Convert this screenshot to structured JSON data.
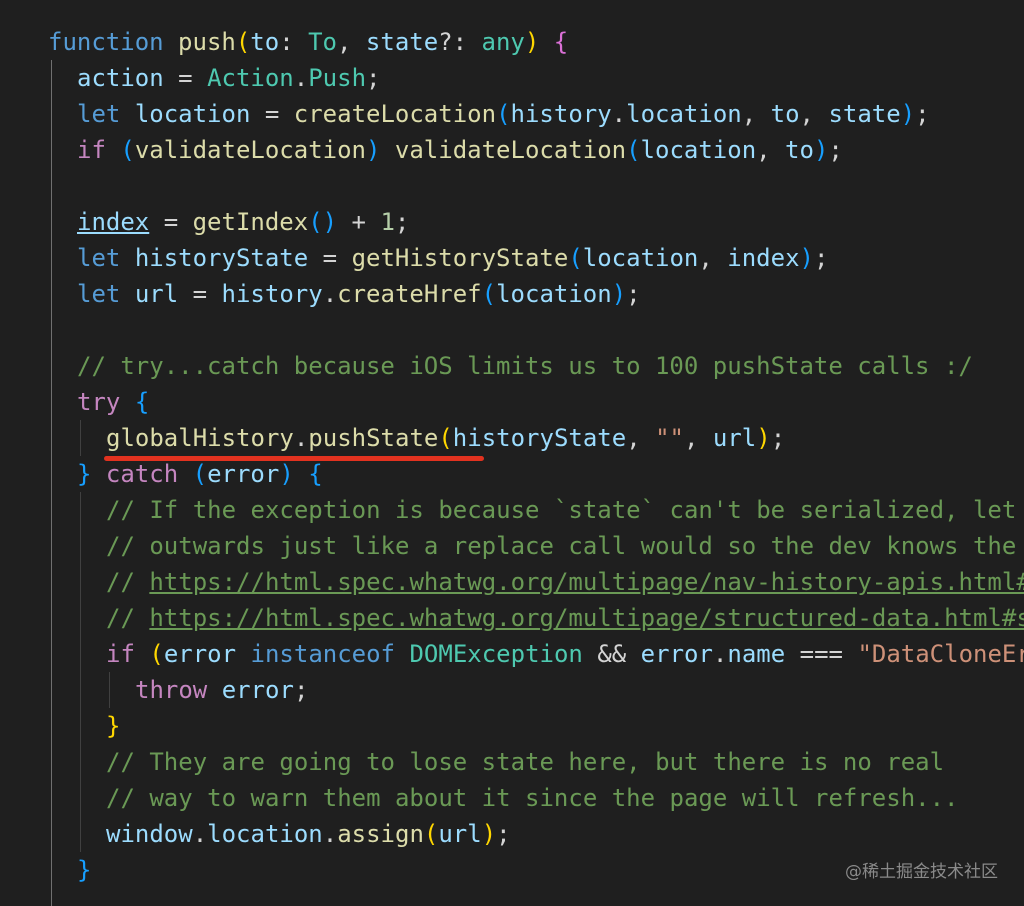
{
  "editor": {
    "code": {
      "fn_kw": "function",
      "fn_name": "push",
      "param_to": "to",
      "colon": ": ",
      "type_to": "To",
      "param_state": "state",
      "opt_colon": "?: ",
      "type_any": "any",
      "action": "action",
      "action_enum": "Action",
      "push_prop": "Push",
      "let_kw": "let",
      "location": "location",
      "createLocation": "createLocation",
      "history": "history",
      "to": "to",
      "state": "state",
      "if_kw": "if",
      "validateLocation": "validateLocation",
      "index": "index",
      "getIndex": "getIndex",
      "one": "1",
      "historyState": "historyState",
      "getHistoryState": "getHistoryState",
      "url": "url",
      "createHref": "createHref",
      "comment_try": "// try...catch because iOS limits us to 100 pushState calls :/",
      "try_kw": "try",
      "globalHistory": "globalHistory",
      "pushState": "pushState",
      "empty_str": "\"\"",
      "catch_kw": "catch",
      "error": "error",
      "comment_1": "// If the exception is because `state` can't be serialized, let",
      "comment_2": "// outwards just like a replace call would so the dev knows the",
      "comment_slash": "// ",
      "url_1": "https://html.spec.whatwg.org/multipage/nav-history-apis.html#",
      "url_2": "https://html.spec.whatwg.org/multipage/structured-data.html#s",
      "instanceof_kw": "instanceof",
      "DOMException": "DOMException",
      "and": "&&",
      "name": "name",
      "eq": "===",
      "dataclone_str": "\"DataCloneEr",
      "throw_kw": "throw",
      "comment_3": "// They are going to lose state here, but there is no real",
      "comment_4": "// way to warn them about it since the page will refresh...",
      "window": "window",
      "assign": "assign"
    },
    "colors": {
      "background": "#1f1f1f",
      "keyword": "#569cd6",
      "control_keyword": "#c586c0",
      "function": "#dcdcaa",
      "variable": "#9cdcfe",
      "type": "#4ec9b0",
      "string": "#ce9178",
      "number": "#b5cea8",
      "comment": "#6a9955",
      "annotation_underline": "#e2321f"
    }
  },
  "watermark": "@稀土掘金技术社区"
}
